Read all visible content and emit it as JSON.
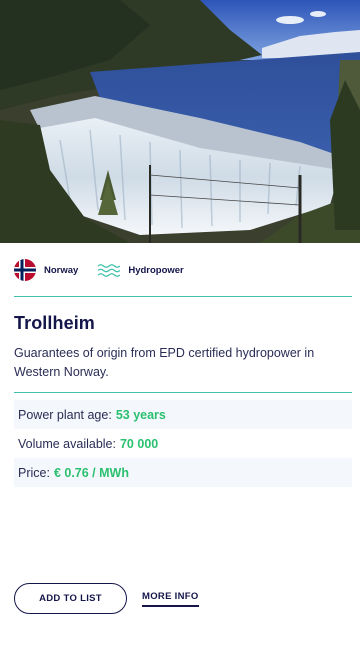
{
  "hero": {
    "image": "hydropower-dam-waterfall"
  },
  "tags": [
    {
      "icon": "norway-flag-icon",
      "label": "Norway"
    },
    {
      "icon": "water-waves-icon",
      "label": "Hydropower"
    }
  ],
  "plant": {
    "title": "Trollheim",
    "description": "Guarantees of origin from EPD certified hydropower in Western Norway."
  },
  "details": {
    "age_label": "Power plant age:",
    "age_value": "53 years",
    "volume_label": "Volume available:",
    "volume_value": "70 000",
    "price_label": "Price:",
    "price_value": "€ 0.76 / MWh"
  },
  "actions": {
    "add_label": "ADD TO LIST",
    "more_label": "MORE INFO"
  },
  "colors": {
    "navy": "#14164a",
    "teal": "#3fc1ac",
    "green": "#2bc070",
    "row_shade": "#f4f7fb"
  }
}
